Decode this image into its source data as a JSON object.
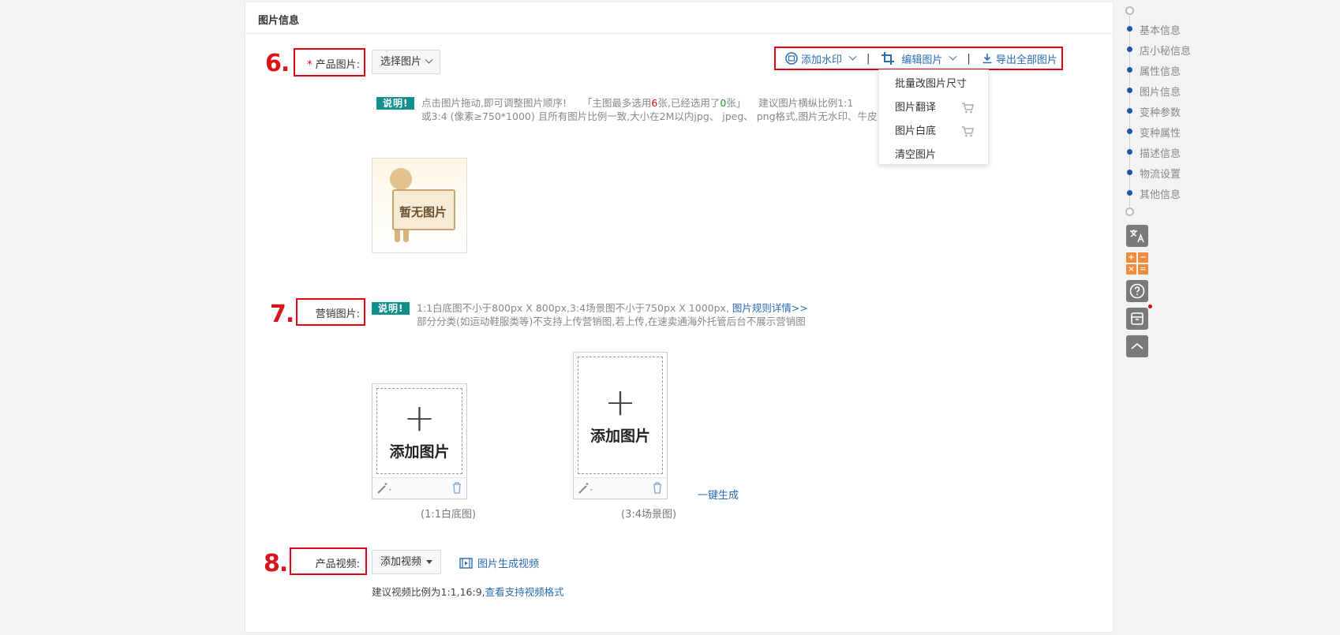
{
  "section": {
    "title": "图片信息"
  },
  "steps": {
    "s6": "6.",
    "s7": "7.",
    "s8": "8."
  },
  "product_images": {
    "required_mark": "*",
    "label": "产品图片:",
    "select_button": "选择图片",
    "toolbar": {
      "watermark": "添加水印",
      "separator": "|",
      "edit": "编辑图片",
      "export": "导出全部图片"
    },
    "edit_menu": [
      {
        "label": "批量改图片尺寸",
        "cart": false
      },
      {
        "label": "图片翻译",
        "cart": true
      },
      {
        "label": "图片白底",
        "cart": true
      },
      {
        "label": "清空图片",
        "cart": false
      }
    ],
    "note_badge": "说明!",
    "note_line1_a": "点击图片拖动,即可调整图片顺序!",
    "note_line1_b": "「主图最多选用",
    "note_max": "6",
    "note_line1_c": "张,已经选用了",
    "note_used": "0",
    "note_line1_d": "张」",
    "note_line1_e": "建议图片横纵比例1:1",
    "note_line2": "或3:4 (像素≥750*1000) 且所有图片比例一致,大小在2M以内jpg、 jpeg、 png格式,图片无水印、牛皮",
    "placeholder_text": "暂无图片"
  },
  "marketing_images": {
    "label": "营销图片:",
    "note_badge": "说明!",
    "note_line1": "1:1白底图不小于800px X 800px,3:4场景图不小于750px X 1000px,",
    "note_link": "图片规则详情>>",
    "note_line2": "部分分类(如运动鞋服类等)不支持上传营销图,若上传,在速卖通海外托管后台不展示营销图",
    "upload_label": "添加图片",
    "caption_square": "(1:1白底图)",
    "caption_scene": "(3:4场景图)",
    "one_click": "一键生成"
  },
  "product_video": {
    "label": "产品视频:",
    "add_button": "添加视频",
    "generate_link": "图片生成视频",
    "hint": "建议视频比例为1:1,16:9,",
    "hint_link": "查看支持视频格式"
  },
  "right_nav": {
    "items": [
      "基本信息",
      "店小秘信息",
      "属性信息",
      "图片信息",
      "变种参数",
      "变种属性",
      "描述信息",
      "物流设置",
      "其他信息"
    ]
  },
  "colors": {
    "accent_red": "#e60012",
    "link_blue": "#2a6bb5",
    "badge_teal": "#118f8f",
    "nav_dot": "#1e55a8"
  }
}
